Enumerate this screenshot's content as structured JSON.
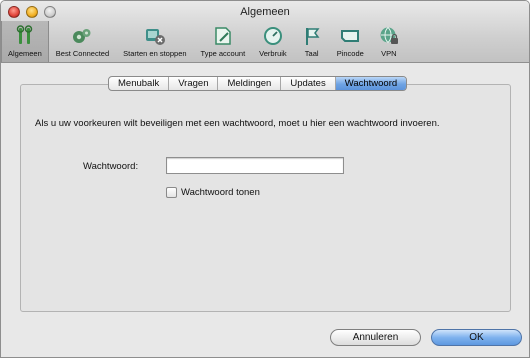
{
  "window": {
    "title": "Algemeen"
  },
  "toolbar": {
    "items": [
      {
        "label": "Algemeen",
        "icon": "wrench-screwdriver-icon"
      },
      {
        "label": "Best Connected",
        "icon": "gears-icon"
      },
      {
        "label": "Starten en stoppen",
        "icon": "network-stop-icon"
      },
      {
        "label": "Type account",
        "icon": "document-edit-icon"
      },
      {
        "label": "Verbruik",
        "icon": "gauge-icon"
      },
      {
        "label": "Taal",
        "icon": "flag-icon"
      },
      {
        "label": "Pincode",
        "icon": "sim-card-icon"
      },
      {
        "label": "VPN",
        "icon": "globe-lock-icon"
      }
    ]
  },
  "tabs": [
    "Menubalk",
    "Vragen",
    "Meldingen",
    "Updates",
    "Wachtwoord"
  ],
  "active_tab": "Wachtwoord",
  "content": {
    "intro": "Als u uw voorkeuren wilt beveiligen met een wachtwoord, moet u hier een wachtwoord invoeren.",
    "password_label": "Wachtwoord:",
    "password_value": "",
    "show_password_label": "Wachtwoord tonen"
  },
  "buttons": {
    "cancel": "Annuleren",
    "ok": "OK"
  },
  "colors": {
    "accent": "#5e98e0"
  }
}
